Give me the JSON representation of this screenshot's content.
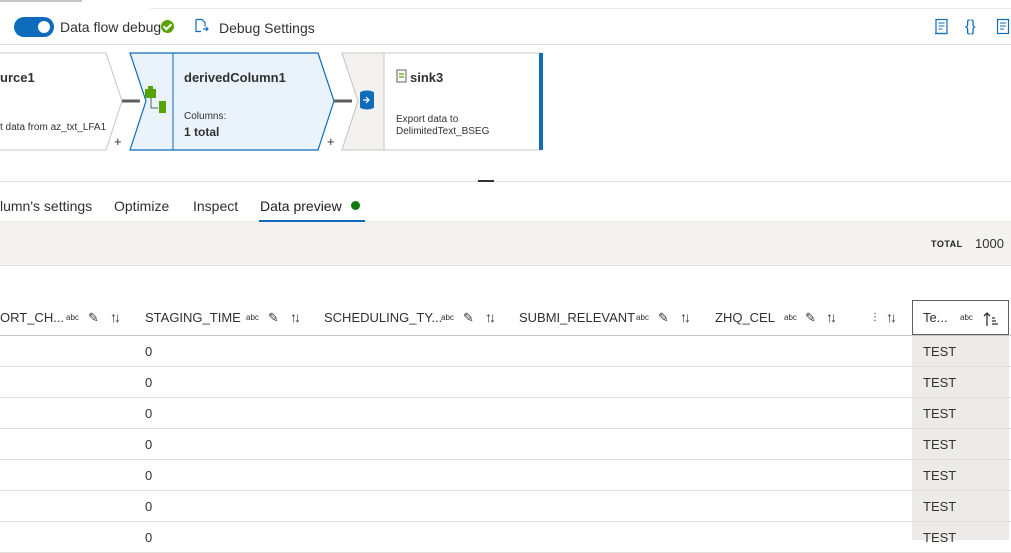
{
  "toolbar": {
    "debug_label": "Data flow debug",
    "debug_on": true,
    "debug_settings_label": "Debug Settings",
    "icons": [
      "script-icon",
      "braces-icon",
      "properties-icon"
    ]
  },
  "canvas": {
    "source": {
      "title": "urce1",
      "desc": "t data from az_txt_LFA1"
    },
    "derived": {
      "title": "derivedColumn1",
      "columns_label": "Columns:",
      "columns_value": "1 total"
    },
    "sink": {
      "title": "sink3",
      "desc_line1": "Export data to",
      "desc_line2": "DelimitedText_BSEG"
    },
    "plus": "+"
  },
  "tabs": {
    "items": [
      "lumn's settings",
      "Optimize",
      "Inspect",
      "Data preview"
    ],
    "active": "Data preview"
  },
  "summary": {
    "total_label": "TOTAL",
    "total_value": "1000"
  },
  "grid": {
    "type_tag": "abc",
    "columns": [
      "ORT_CH...",
      "STAGING_TIME",
      "SCHEDULING_TY...",
      "SUBMI_RELEVANT",
      "ZHQ_CEL",
      "Te..."
    ],
    "rows": [
      [
        "0",
        "TEST"
      ],
      [
        "0",
        "TEST"
      ],
      [
        "0",
        "TEST"
      ],
      [
        "0",
        "TEST"
      ],
      [
        "0",
        "TEST"
      ],
      [
        "0",
        "TEST"
      ],
      [
        "0",
        "TEST"
      ]
    ]
  },
  "colors": {
    "accent": "#0f6cbd",
    "success": "#57a300",
    "preview_dot": "#107c10"
  }
}
